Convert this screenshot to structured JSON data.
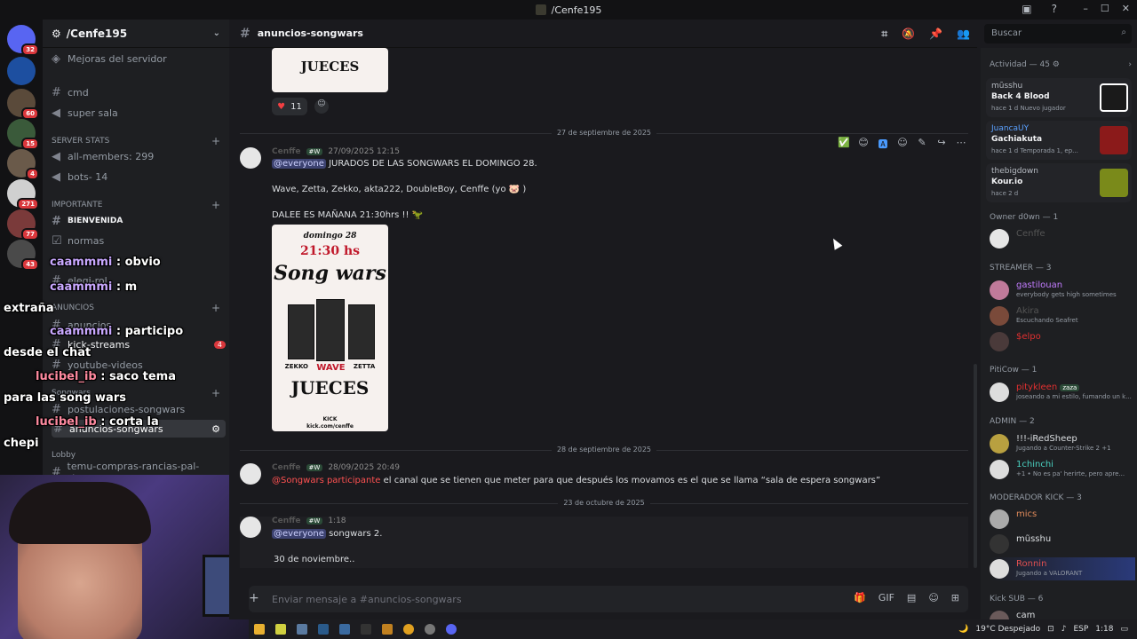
{
  "window": {
    "title": "/Cenfe195"
  },
  "server": {
    "name": "/Cenfe195",
    "boost": "Mejoras del servidor"
  },
  "channels": [
    {
      "name": "cmd"
    },
    {
      "name": "super sala"
    }
  ],
  "categories": {
    "stats": "SERVER STATS",
    "importante": "IMPORTANTE",
    "anuncios": "ANUNCIOS",
    "songwars": "Songwars",
    "lobby": "Lobby"
  },
  "stat_channels": {
    "members": "all-members: 299",
    "bots": "bots- 14"
  },
  "imp_channels": {
    "bienvenida": "BIENVENIDA",
    "normas": "normas",
    "roles": "elegi-rol"
  },
  "anun_channels": {
    "anuncios": "anuncios",
    "kick": "kick-streams",
    "yt": "youtube-videos",
    "kick_badge": "4"
  },
  "sw_channels": {
    "post": "postulaciones-songwars",
    "anun": "anuncios-songwars"
  },
  "lobby_channels": {
    "temu": "temu-compras-rancias-pal-stream"
  },
  "guild_badges": [
    "32",
    "60",
    "15",
    "4",
    "271",
    "77",
    "43"
  ],
  "overlay_chat": [
    {
      "user": "caammmi",
      "text": ": obvio"
    },
    {
      "user": "caammmi",
      "text": ": m"
    },
    {
      "user": "",
      "text": "extraña"
    },
    {
      "user": "caammmi",
      "text": ": participo"
    },
    {
      "user": "",
      "text": "desde el chat"
    },
    {
      "user": "lucibel_ib",
      "text": ": saco tema"
    },
    {
      "user": "",
      "text": "para las song wars"
    },
    {
      "user": "lucibel_ib",
      "text": ": corta la"
    },
    {
      "user": "",
      "text": "chepi"
    }
  ],
  "channel_header": {
    "name": "anuncios-songwars"
  },
  "search": {
    "placeholder": "Buscar"
  },
  "composer": {
    "placeholder": "Enviar mensaje a #anuncios-songwars"
  },
  "reaction": {
    "count": "11"
  },
  "dividers": [
    "27 de septiembre de 2025",
    "28 de septiembre de 2025",
    "23 de octubre de 2025"
  ],
  "messages": [
    {
      "author": "Cenffe",
      "tag": "#W",
      "time": "27/09/2025 12:15",
      "mention": "@everyone",
      "line1": "JURADOS DE LAS SONGWARS EL DOMINGO 28.",
      "line2": "Wave, Zetta, Zekko, akta222, DoubleBoy, Cenffe (yo 🐷 )",
      "line3": "DALEE ES MAÑANA 21:30hrs !! 🦖"
    },
    {
      "author": "Cenffe",
      "tag": "#W",
      "time": "28/09/2025 20:49",
      "mention": "@Songwars participante",
      "line1": "el canal que se tienen que meter para que después los movamos es el que se llama “sala de espera songwars”"
    },
    {
      "author": "Cenffe",
      "tag": "#W",
      "time": "1:18",
      "mention": "@everyone",
      "line1": "songwars 2.",
      "line2": "30 de noviembre.."
    }
  ],
  "poster": {
    "date": "domingo 28",
    "time": "21:30 hs",
    "title": "Song wars",
    "names": [
      "ZEKKO",
      "WAVE",
      "ZETTA"
    ],
    "jueces": "JUECES",
    "kick": "KICK",
    "url": "kick.com/cenffe"
  },
  "poster_top": {
    "jueces": "JUECES"
  },
  "members": {
    "activity_title": "Actividad — 45",
    "activities": [
      {
        "user": "mũsshu",
        "game": "Back 4 Blood",
        "meta": "hace 1 d   Nuevo jugador",
        "color": "#1a1a1a"
      },
      {
        "user": "JuancaUY",
        "game": "Gachiakuta",
        "meta": "hace 1 d   Temporada 1, ep...",
        "color": "#8b1a1a"
      },
      {
        "user": "thebigdown",
        "game": "Kour.io",
        "meta": "hace 2 d",
        "color": "#7a8a1a"
      }
    ],
    "owner": "Owner d0wn — 1",
    "owner_name": "Cenffe",
    "streamer": "STREAMER — 3",
    "streamers": [
      {
        "name": "gastilouan",
        "status": "everybody gets high sometimes",
        "color": "#c27cff"
      },
      {
        "name": "Akira",
        "status": "Escuchando Seafret",
        "color": "#555"
      },
      {
        "name": "$elpo",
        "status": "",
        "color": "#e03030"
      }
    ],
    "piticow": "PitiCow — 1",
    "piti": {
      "name": "pitykleen",
      "tag": "zaza",
      "status": "joseando a mi estilo, fumando un k..."
    },
    "admin": "ADMIN — 2",
    "admins": [
      {
        "name": "!!!-iRedSheep",
        "status": "Jugando a Counter-Strike 2 +1"
      },
      {
        "name": "1chinchi",
        "status": "+1 • No es pa' herirte, pero apre..."
      }
    ],
    "mod": "MODERADOR KICK — 3",
    "mods": [
      {
        "name": "mics",
        "status": "",
        "color": "#e08a5a"
      },
      {
        "name": "mũsshu",
        "status": "",
        "color": "#dbdee1"
      },
      {
        "name": "Ronnin",
        "status": "Jugando a VALORANT",
        "color": "#e05050"
      }
    ],
    "kicksub": "Kick SUB — 6",
    "ksub": {
      "name": "cam"
    }
  },
  "taskbar": {
    "weather": "19°C  Despejado",
    "lang": "ESP",
    "time": "1:18"
  },
  "colors": {
    "bg": "#1a1a1e",
    "accent": "#5865f2",
    "mention": "#da373c"
  }
}
